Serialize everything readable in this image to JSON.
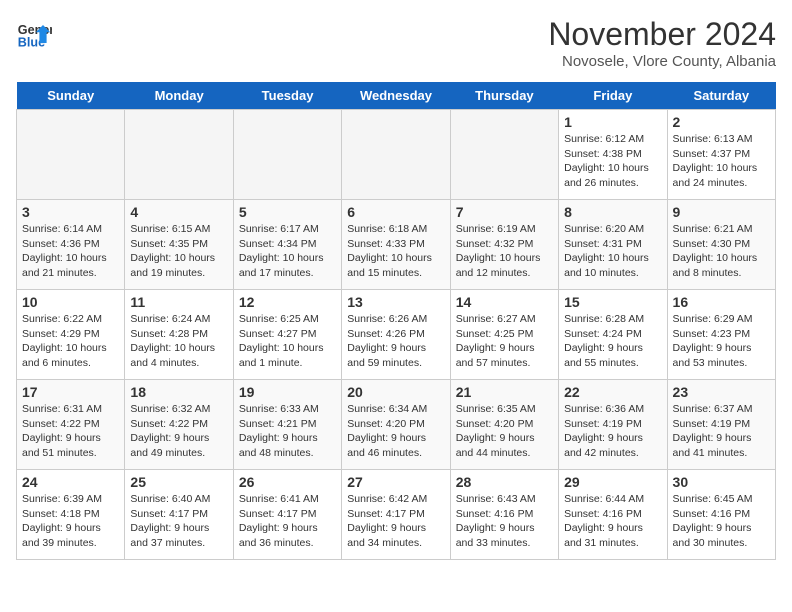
{
  "header": {
    "logo_general": "General",
    "logo_blue": "Blue",
    "title": "November 2024",
    "subtitle": "Novosele, Vlore County, Albania"
  },
  "days_of_week": [
    "Sunday",
    "Monday",
    "Tuesday",
    "Wednesday",
    "Thursday",
    "Friday",
    "Saturday"
  ],
  "weeks": [
    [
      {
        "day": "",
        "info": ""
      },
      {
        "day": "",
        "info": ""
      },
      {
        "day": "",
        "info": ""
      },
      {
        "day": "",
        "info": ""
      },
      {
        "day": "",
        "info": ""
      },
      {
        "day": "1",
        "info": "Sunrise: 6:12 AM\nSunset: 4:38 PM\nDaylight: 10 hours and 26 minutes."
      },
      {
        "day": "2",
        "info": "Sunrise: 6:13 AM\nSunset: 4:37 PM\nDaylight: 10 hours and 24 minutes."
      }
    ],
    [
      {
        "day": "3",
        "info": "Sunrise: 6:14 AM\nSunset: 4:36 PM\nDaylight: 10 hours and 21 minutes."
      },
      {
        "day": "4",
        "info": "Sunrise: 6:15 AM\nSunset: 4:35 PM\nDaylight: 10 hours and 19 minutes."
      },
      {
        "day": "5",
        "info": "Sunrise: 6:17 AM\nSunset: 4:34 PM\nDaylight: 10 hours and 17 minutes."
      },
      {
        "day": "6",
        "info": "Sunrise: 6:18 AM\nSunset: 4:33 PM\nDaylight: 10 hours and 15 minutes."
      },
      {
        "day": "7",
        "info": "Sunrise: 6:19 AM\nSunset: 4:32 PM\nDaylight: 10 hours and 12 minutes."
      },
      {
        "day": "8",
        "info": "Sunrise: 6:20 AM\nSunset: 4:31 PM\nDaylight: 10 hours and 10 minutes."
      },
      {
        "day": "9",
        "info": "Sunrise: 6:21 AM\nSunset: 4:30 PM\nDaylight: 10 hours and 8 minutes."
      }
    ],
    [
      {
        "day": "10",
        "info": "Sunrise: 6:22 AM\nSunset: 4:29 PM\nDaylight: 10 hours and 6 minutes."
      },
      {
        "day": "11",
        "info": "Sunrise: 6:24 AM\nSunset: 4:28 PM\nDaylight: 10 hours and 4 minutes."
      },
      {
        "day": "12",
        "info": "Sunrise: 6:25 AM\nSunset: 4:27 PM\nDaylight: 10 hours and 1 minute."
      },
      {
        "day": "13",
        "info": "Sunrise: 6:26 AM\nSunset: 4:26 PM\nDaylight: 9 hours and 59 minutes."
      },
      {
        "day": "14",
        "info": "Sunrise: 6:27 AM\nSunset: 4:25 PM\nDaylight: 9 hours and 57 minutes."
      },
      {
        "day": "15",
        "info": "Sunrise: 6:28 AM\nSunset: 4:24 PM\nDaylight: 9 hours and 55 minutes."
      },
      {
        "day": "16",
        "info": "Sunrise: 6:29 AM\nSunset: 4:23 PM\nDaylight: 9 hours and 53 minutes."
      }
    ],
    [
      {
        "day": "17",
        "info": "Sunrise: 6:31 AM\nSunset: 4:22 PM\nDaylight: 9 hours and 51 minutes."
      },
      {
        "day": "18",
        "info": "Sunrise: 6:32 AM\nSunset: 4:22 PM\nDaylight: 9 hours and 49 minutes."
      },
      {
        "day": "19",
        "info": "Sunrise: 6:33 AM\nSunset: 4:21 PM\nDaylight: 9 hours and 48 minutes."
      },
      {
        "day": "20",
        "info": "Sunrise: 6:34 AM\nSunset: 4:20 PM\nDaylight: 9 hours and 46 minutes."
      },
      {
        "day": "21",
        "info": "Sunrise: 6:35 AM\nSunset: 4:20 PM\nDaylight: 9 hours and 44 minutes."
      },
      {
        "day": "22",
        "info": "Sunrise: 6:36 AM\nSunset: 4:19 PM\nDaylight: 9 hours and 42 minutes."
      },
      {
        "day": "23",
        "info": "Sunrise: 6:37 AM\nSunset: 4:19 PM\nDaylight: 9 hours and 41 minutes."
      }
    ],
    [
      {
        "day": "24",
        "info": "Sunrise: 6:39 AM\nSunset: 4:18 PM\nDaylight: 9 hours and 39 minutes."
      },
      {
        "day": "25",
        "info": "Sunrise: 6:40 AM\nSunset: 4:17 PM\nDaylight: 9 hours and 37 minutes."
      },
      {
        "day": "26",
        "info": "Sunrise: 6:41 AM\nSunset: 4:17 PM\nDaylight: 9 hours and 36 minutes."
      },
      {
        "day": "27",
        "info": "Sunrise: 6:42 AM\nSunset: 4:17 PM\nDaylight: 9 hours and 34 minutes."
      },
      {
        "day": "28",
        "info": "Sunrise: 6:43 AM\nSunset: 4:16 PM\nDaylight: 9 hours and 33 minutes."
      },
      {
        "day": "29",
        "info": "Sunrise: 6:44 AM\nSunset: 4:16 PM\nDaylight: 9 hours and 31 minutes."
      },
      {
        "day": "30",
        "info": "Sunrise: 6:45 AM\nSunset: 4:16 PM\nDaylight: 9 hours and 30 minutes."
      }
    ]
  ]
}
